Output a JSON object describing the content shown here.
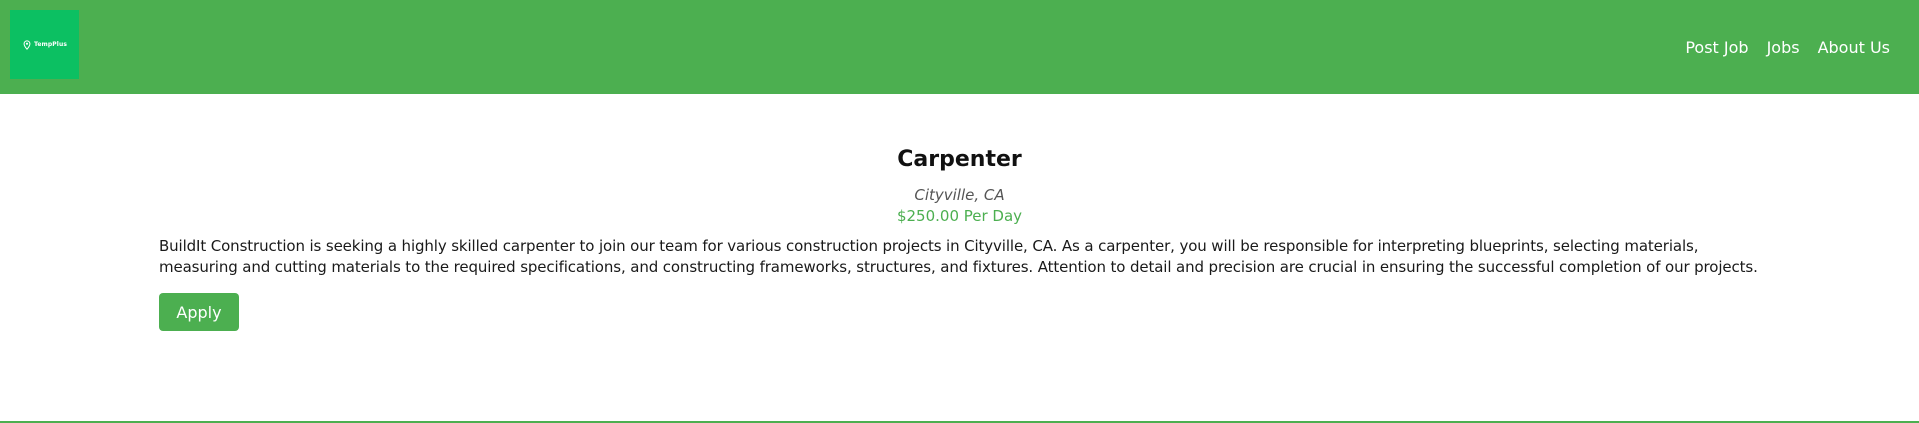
{
  "brand": {
    "name": "TempPlus",
    "icon": "map-pin-icon"
  },
  "colors": {
    "header": "#4caf50",
    "logo_bg": "#0cc062",
    "accent": "#4caf50",
    "location_text": "#555555"
  },
  "nav": {
    "items": [
      {
        "label": "Post Job"
      },
      {
        "label": "Jobs"
      },
      {
        "label": "About Us"
      }
    ]
  },
  "job": {
    "title": "Carpenter",
    "location": "Cityville, CA",
    "pay": "$250.00 Per Day",
    "description": "BuildIt Construction is seeking a highly skilled carpenter to join our team for various construction projects in Cityville, CA. As a carpenter, you will be responsible for interpreting blueprints, selecting materials, measuring and cutting materials to the required specifications, and constructing frameworks, structures, and fixtures. Attention to detail and precision are crucial in ensuring the successful completion of our projects.",
    "apply_label": "Apply"
  }
}
